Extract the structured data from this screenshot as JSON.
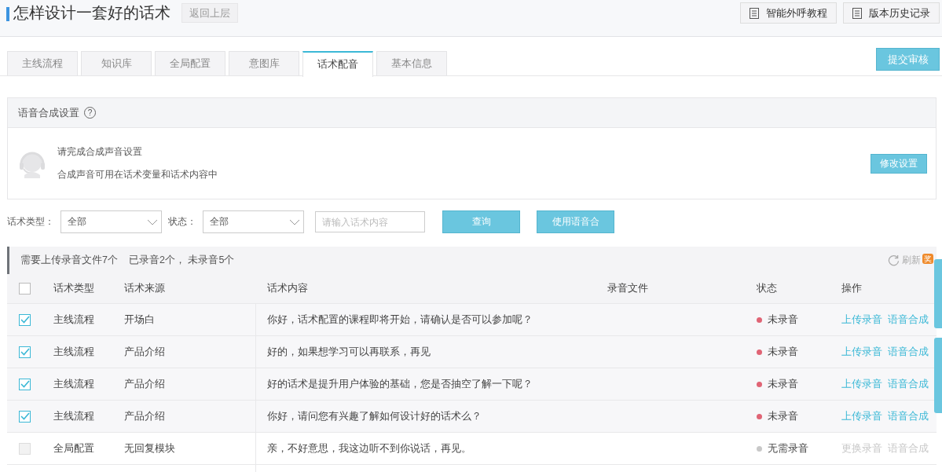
{
  "header": {
    "title": "怎样设计一套好的话术",
    "back_button": "返回上层",
    "buttons": [
      "智能外呼教程",
      "版本历史记录"
    ]
  },
  "tabs": [
    {
      "label": "主线流程",
      "selected": false
    },
    {
      "label": "知识库",
      "selected": false
    },
    {
      "label": "全局配置",
      "selected": false
    },
    {
      "label": "意图库",
      "selected": false
    },
    {
      "label": "话术配音",
      "selected": true
    },
    {
      "label": "基本信息",
      "selected": false
    }
  ],
  "submit_button": "提交审核",
  "voice_panel": {
    "title": "语音合成设置",
    "help_mark": "?",
    "line_1": "请完成合成声音设置",
    "line_2": "合成声音可用在话术变量和话术内容中",
    "button": "修改设置"
  },
  "filters": {
    "type_label": "话术类型：",
    "type_value": "全部",
    "status_label": "状态：",
    "status_value": "全部",
    "search": {
      "placeholder": "请输入话术内容"
    },
    "buttons": [
      "查询",
      "使用语音合"
    ]
  },
  "summary": {
    "total": "需要上传录音文件7个",
    "counts": "已录音2个， 未录音5个",
    "refresh": "刷新",
    "badge": "奖"
  },
  "table": {
    "header_checked": false,
    "columns": [
      "话术类型",
      "话术来源",
      "话术内容",
      "录音文件",
      "状态",
      "操作"
    ],
    "rows": [
      {
        "checked": true,
        "disabled": false,
        "type": "主线流程",
        "source": "开场白",
        "content": "你好，话术配置的课程即将开始，请确认是否可以参加呢？",
        "status": "未录音",
        "color": "#e06475",
        "actions": [
          {
            "label": "上传录音",
            "disabled": false
          },
          {
            "label": "语音合成",
            "disabled": false
          }
        ]
      },
      {
        "checked": true,
        "disabled": false,
        "type": "主线流程",
        "source": "产品介绍",
        "content": "好的，如果想学习可以再联系，再见",
        "status": "未录音",
        "color": "#e06475",
        "actions": [
          {
            "label": "上传录音",
            "disabled": false
          },
          {
            "label": "语音合成",
            "disabled": false
          }
        ]
      },
      {
        "checked": true,
        "disabled": false,
        "type": "主线流程",
        "source": "产品介绍",
        "content": "好的话术是提升用户体验的基础，您是否抽空了解一下呢？",
        "status": "未录音",
        "color": "#e06475",
        "actions": [
          {
            "label": "上传录音",
            "disabled": false
          },
          {
            "label": "语音合成",
            "disabled": false
          }
        ]
      },
      {
        "checked": true,
        "disabled": false,
        "type": "主线流程",
        "source": "产品介绍",
        "content": "你好，请问您有兴趣了解如何设计好的话术么？",
        "status": "未录音",
        "color": "#e06475",
        "actions": [
          {
            "label": "上传录音",
            "disabled": false
          },
          {
            "label": "语音合成",
            "disabled": false
          }
        ]
      },
      {
        "checked": false,
        "disabled": true,
        "type": "全局配置",
        "source": "无回复模块",
        "content": "亲，不好意思，我这边听不到你说话，再见。",
        "status": "无需录音",
        "color": "#c8c8c8",
        "actions": [
          {
            "label": "更换录音",
            "disabled": true
          },
          {
            "label": "语音合成",
            "disabled": true
          }
        ]
      }
    ]
  }
}
